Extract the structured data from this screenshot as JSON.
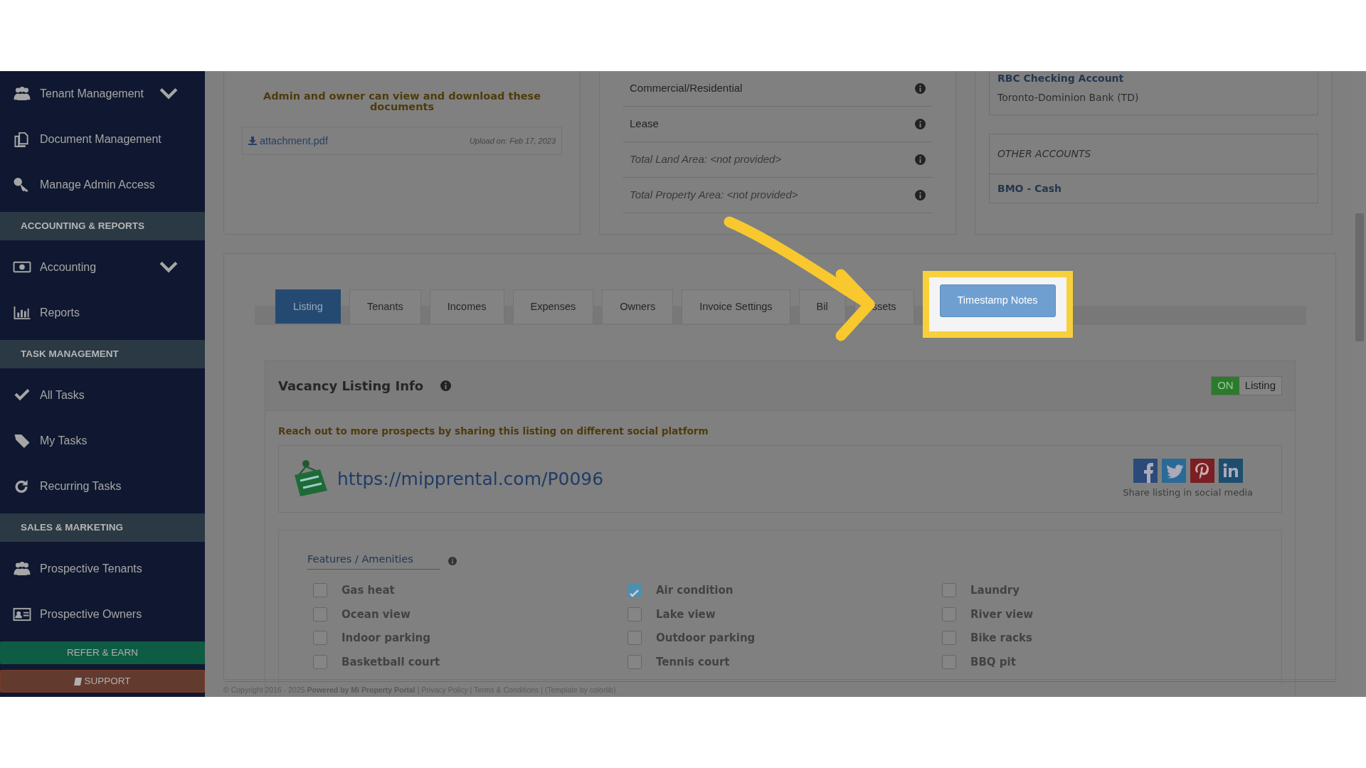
{
  "sidebar": {
    "items": [
      {
        "kind": "item",
        "label": "Tenant Management",
        "expandable": true
      },
      {
        "kind": "item",
        "label": "Document Management",
        "expandable": false
      },
      {
        "kind": "item",
        "label": "Manage Admin Access",
        "expandable": false
      },
      {
        "kind": "header",
        "label": "ACCOUNTING & REPORTS"
      },
      {
        "kind": "item",
        "label": "Accounting",
        "expandable": true
      },
      {
        "kind": "item",
        "label": "Reports",
        "expandable": false
      },
      {
        "kind": "header",
        "label": "TASK MANAGEMENT"
      },
      {
        "kind": "item",
        "label": "All Tasks",
        "expandable": false
      },
      {
        "kind": "item",
        "label": "My Tasks",
        "expandable": false
      },
      {
        "kind": "item",
        "label": "Recurring Tasks",
        "expandable": false
      },
      {
        "kind": "header",
        "label": "SALES & MARKETING"
      },
      {
        "kind": "item",
        "label": "Prospective Tenants",
        "expandable": false
      },
      {
        "kind": "item",
        "label": "Prospective Owners",
        "expandable": false
      }
    ],
    "buttons": [
      {
        "kind": "refer",
        "label": "REFER & EARN"
      },
      {
        "kind": "support",
        "label": "SUPPORT"
      }
    ]
  },
  "documents_card": {
    "heading": "Admin and owner can view and download these documents",
    "file": {
      "name": "attachment.pdf",
      "uploaded": "Upload on: Feb 17, 2023"
    }
  },
  "property_card": {
    "rows": [
      {
        "text": "Commercial/Residential",
        "italic": false
      },
      {
        "text": "Lease",
        "italic": false
      },
      {
        "text": "Total Land Area: <not provided>",
        "italic": true
      },
      {
        "text": "Total Property Area: <not provided>",
        "italic": true
      }
    ]
  },
  "accounts_card": {
    "account": {
      "name": "RBC Checking Account",
      "bank": "Toronto-Dominion Bank (TD)"
    },
    "other_accounts": {
      "heading": "OTHER ACCOUNTS",
      "items": [
        "BMO - Cash"
      ]
    }
  },
  "tabs": [
    {
      "label": "Listing",
      "selected": true,
      "highlighted": false
    },
    {
      "label": "Tenants",
      "selected": false,
      "highlighted": false
    },
    {
      "label": "Incomes",
      "selected": false,
      "highlighted": false
    },
    {
      "label": "Expenses",
      "selected": false,
      "highlighted": false
    },
    {
      "label": "Owners",
      "selected": false,
      "highlighted": false
    },
    {
      "label": "Invoice Settings",
      "selected": false,
      "highlighted": false
    },
    {
      "label": "Bil",
      "selected": false,
      "highlighted": false
    },
    {
      "label": "ssets",
      "selected": false,
      "highlighted": false
    },
    {
      "label": "Timestamp Notes",
      "selected": false,
      "highlighted": true
    }
  ],
  "listing": {
    "title": "Vacancy Listing Info",
    "toggle": {
      "on": true,
      "on_label": "ON",
      "label": "Listing"
    },
    "share_prompt": "Reach out to more prospects by sharing this listing on different social platform",
    "url": "https://mipprental.com/P0096",
    "share_caption": "Share listing in social media",
    "features": {
      "heading": "Features / Amenities",
      "items": [
        {
          "label": "Gas heat",
          "checked": false
        },
        {
          "label": "Air condition",
          "checked": true
        },
        {
          "label": "Laundry",
          "checked": false
        },
        {
          "label": "Ocean view",
          "checked": false
        },
        {
          "label": "Lake view",
          "checked": false
        },
        {
          "label": "River view",
          "checked": false
        },
        {
          "label": "Indoor parking",
          "checked": false
        },
        {
          "label": "Outdoor parking",
          "checked": false
        },
        {
          "label": "Bike racks",
          "checked": false
        },
        {
          "label": "Basketball court",
          "checked": false
        },
        {
          "label": "Tennis court",
          "checked": false
        },
        {
          "label": "BBQ pit",
          "checked": false
        }
      ]
    }
  },
  "footer": {
    "text": "© Copyright 2016 - 2025 **Powered by Mi Property Portal** | Privacy Policy | Terms & Conditions | (Template by colorlib)"
  }
}
